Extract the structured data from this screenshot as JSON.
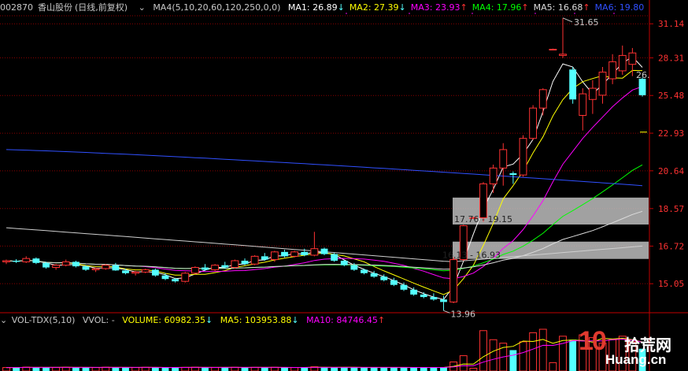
{
  "stock": {
    "code": "002870",
    "name": "香山股份",
    "mode": "(日线,前复权)"
  },
  "ma_header": {
    "indicator": "MA4(5,10,20,60,120,250,0,0)",
    "items": [
      {
        "label": "MA1: 26.89",
        "arrow": "↓",
        "color": "#ffffff"
      },
      {
        "label": "MA2: 27.39",
        "arrow": "↓",
        "color": "#ffff00"
      },
      {
        "label": "MA3: 23.93",
        "arrow": "↑",
        "color": "#ff00ff"
      },
      {
        "label": "MA4: 17.96",
        "arrow": "↑",
        "color": "#00ff00"
      },
      {
        "label": "MA5: 16.68",
        "arrow": "↑",
        "color": "#dcdcdc"
      },
      {
        "label": "MA6: 19.80",
        "arrow": "",
        "color": "#3050ff"
      }
    ]
  },
  "vol_header": {
    "indicator": "VOL-TDX(5,10)",
    "vvol": "VVOL: -",
    "volume": {
      "label": "VOLUME: 60982.35",
      "arrow": "↓",
      "color": "#ffff00"
    },
    "ma5": {
      "label": "MA5: 103953.88",
      "arrow": "↓",
      "color": "#ffff00"
    },
    "ma10": {
      "label": "MA10: 84746.45",
      "arrow": "↑",
      "color": "#ff00ff"
    }
  },
  "price_axis": [
    "31.14",
    "28.31",
    "25.48",
    "22.93",
    "20.64",
    "18.57",
    "16.72",
    "15.05"
  ],
  "annotations": {
    "high": "31.65",
    "low": "13.96",
    "last": "26.",
    "zone_upper": "17.76 - 19.15",
    "zone_lower": "16.13 - 16.93"
  },
  "watermark": {
    "big": "10",
    "cn": "拾荒网",
    "url": "Huang.cn"
  },
  "colors": {
    "up": "#ff3232",
    "down": "#54ffff",
    "grid": "#8b0000"
  },
  "chart_data": {
    "type": "candlestick",
    "price_range": [
      14.0,
      32.2
    ],
    "zones": [
      {
        "low": 17.76,
        "high": 19.15
      },
      {
        "low": 16.13,
        "high": 16.93
      }
    ],
    "candles": [
      [
        16.0,
        16.1,
        15.9,
        16.05
      ],
      [
        16.05,
        16.12,
        15.95,
        16.0
      ],
      [
        16.0,
        16.25,
        15.95,
        16.15
      ],
      [
        16.15,
        16.2,
        15.9,
        15.95
      ],
      [
        15.95,
        16.0,
        15.7,
        15.75
      ],
      [
        15.75,
        15.9,
        15.65,
        15.85
      ],
      [
        15.85,
        16.1,
        15.8,
        16.0
      ],
      [
        16.0,
        16.05,
        15.75,
        15.8
      ],
      [
        15.8,
        15.85,
        15.6,
        15.65
      ],
      [
        15.65,
        15.75,
        15.55,
        15.7
      ],
      [
        15.7,
        15.9,
        15.65,
        15.85
      ],
      [
        15.85,
        15.95,
        15.6,
        15.62
      ],
      [
        15.62,
        15.7,
        15.45,
        15.5
      ],
      [
        15.5,
        15.6,
        15.4,
        15.55
      ],
      [
        15.55,
        15.7,
        15.5,
        15.65
      ],
      [
        15.65,
        15.7,
        15.35,
        15.4
      ],
      [
        15.4,
        15.5,
        15.2,
        15.25
      ],
      [
        15.25,
        15.3,
        15.1,
        15.15
      ],
      [
        15.15,
        15.55,
        15.1,
        15.5
      ],
      [
        15.5,
        15.8,
        15.45,
        15.75
      ],
      [
        15.75,
        15.9,
        15.6,
        15.65
      ],
      [
        15.65,
        15.9,
        15.6,
        15.85
      ],
      [
        15.85,
        16.0,
        15.7,
        15.75
      ],
      [
        15.75,
        16.1,
        15.7,
        16.05
      ],
      [
        16.05,
        16.15,
        15.85,
        15.9
      ],
      [
        15.9,
        16.3,
        15.85,
        16.25
      ],
      [
        16.25,
        16.4,
        16.05,
        16.1
      ],
      [
        16.1,
        16.5,
        16.0,
        16.45
      ],
      [
        16.45,
        16.55,
        16.2,
        16.25
      ],
      [
        16.25,
        16.5,
        16.2,
        16.45
      ],
      [
        16.45,
        16.6,
        16.25,
        16.3
      ],
      [
        16.3,
        17.4,
        16.25,
        16.6
      ],
      [
        16.6,
        16.65,
        16.3,
        16.35
      ],
      [
        16.35,
        16.4,
        16.0,
        16.05
      ],
      [
        16.05,
        16.1,
        15.8,
        15.85
      ],
      [
        15.85,
        15.95,
        15.6,
        15.65
      ],
      [
        15.65,
        15.7,
        15.45,
        15.5
      ],
      [
        15.5,
        15.6,
        15.3,
        15.35
      ],
      [
        15.35,
        15.45,
        15.15,
        15.2
      ],
      [
        15.2,
        15.3,
        14.95,
        15.0
      ],
      [
        15.0,
        15.1,
        14.75,
        14.8
      ],
      [
        14.8,
        14.9,
        14.55,
        14.6
      ],
      [
        14.6,
        14.7,
        14.45,
        14.5
      ],
      [
        14.5,
        14.65,
        14.35,
        14.4
      ],
      [
        14.4,
        14.55,
        13.96,
        14.3
      ],
      [
        14.3,
        16.2,
        14.25,
        16.1
      ],
      [
        16.1,
        17.75,
        16.05,
        17.7
      ],
      [
        18.1,
        18.15,
        18.05,
        18.1
      ],
      [
        18.1,
        20.0,
        17.9,
        19.9
      ],
      [
        19.9,
        21.0,
        19.4,
        20.8
      ],
      [
        20.8,
        22.3,
        19.8,
        21.9
      ],
      [
        20.5,
        20.6,
        19.9,
        20.4
      ],
      [
        20.4,
        22.8,
        20.3,
        22.6
      ],
      [
        22.6,
        24.8,
        22.5,
        24.6
      ],
      [
        24.6,
        26.0,
        24.1,
        25.9
      ],
      [
        29.0,
        29.05,
        28.95,
        29.0
      ],
      [
        28.5,
        31.65,
        28.3,
        28.6
      ],
      [
        27.4,
        27.6,
        24.9,
        25.2
      ],
      [
        24.1,
        26.0,
        23.1,
        25.6
      ],
      [
        25.2,
        26.6,
        24.2,
        26.0
      ],
      [
        25.5,
        27.6,
        24.9,
        27.2
      ],
      [
        26.7,
        28.6,
        26.3,
        28.0
      ],
      [
        27.3,
        29.3,
        27.0,
        28.5
      ],
      [
        27.8,
        29.1,
        26.9,
        28.7
      ],
      [
        26.7,
        26.8,
        25.4,
        25.5
      ]
    ],
    "volumes": [
      5.0,
      5.0,
      5.5,
      5.2,
      5.4,
      5.0,
      5.3,
      5.1,
      5.2,
      5.0,
      5.4,
      5.2,
      5.0,
      5.1,
      5.3,
      5.2,
      5.0,
      5.1,
      5.2,
      5.4,
      5.1,
      5.0,
      5.2,
      5.3,
      5.1,
      5.2,
      5.0,
      5.3,
      5.1,
      5.0,
      5.2,
      6.0,
      5.1,
      5.0,
      5.2,
      5.1,
      5.0,
      5.2,
      5.1,
      5.0,
      5.1,
      5.2,
      5.0,
      5.1,
      5.3,
      13,
      22,
      4,
      58,
      45,
      40,
      30,
      42,
      55,
      60,
      12,
      50,
      45,
      52,
      48,
      40,
      45,
      50,
      42,
      32
    ]
  }
}
